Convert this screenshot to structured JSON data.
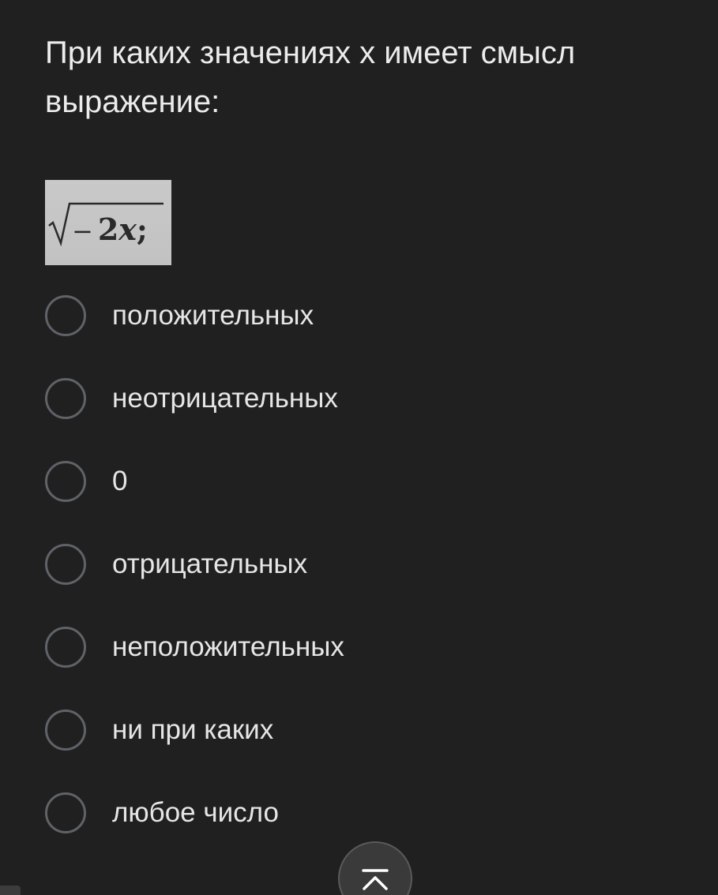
{
  "question": {
    "title": "При каких значениях х имеет смысл выражение:",
    "formula": "√− 2x;"
  },
  "options": [
    {
      "label": "положительных"
    },
    {
      "label": "неотрицательных"
    },
    {
      "label": "0"
    },
    {
      "label": "отрицательных"
    },
    {
      "label": "неположительных"
    },
    {
      "label": "ни при каких"
    },
    {
      "label": "любое число"
    }
  ],
  "icons": {
    "scroll_top": "chevron-up-bar-icon"
  },
  "colors": {
    "background": "#202020",
    "text": "#e6e6e6",
    "radio_border": "#5f6368"
  }
}
